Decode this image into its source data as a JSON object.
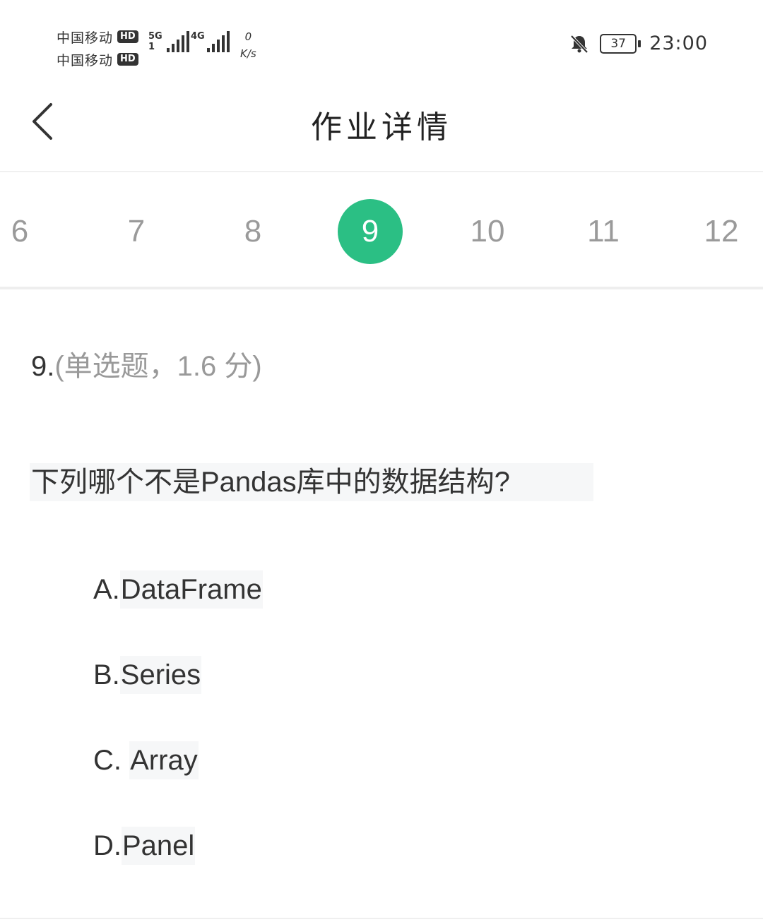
{
  "status_bar": {
    "carrier1": "中国移动",
    "carrier2": "中国移动",
    "hd_badge": "HD",
    "sig1_label_top": "5G",
    "sig1_label_bottom": "1",
    "sig2_label": "4G",
    "net_speed_value": "0",
    "net_speed_unit": "K/s",
    "mute_icon": "bell-off-icon",
    "battery_level": "37",
    "time": "23:00"
  },
  "header": {
    "back_icon": "chevron-left-icon",
    "title": "作业详情"
  },
  "question_tabs": {
    "items": [
      "6",
      "7",
      "8",
      "9",
      "10",
      "11",
      "12"
    ],
    "active": "9",
    "active_color": "#2bbf84"
  },
  "question": {
    "number": "9.",
    "type_label": "(单选题，1.6 分)",
    "stem": "下列哪个不是Pandas库中的数据结构? ",
    "options": [
      {
        "letter": "A.",
        "text": "DataFrame"
      },
      {
        "letter": "B.",
        "text": "Series"
      },
      {
        "letter": "C. ",
        "text": "Array"
      },
      {
        "letter": "D.",
        "text": "Panel"
      }
    ]
  }
}
